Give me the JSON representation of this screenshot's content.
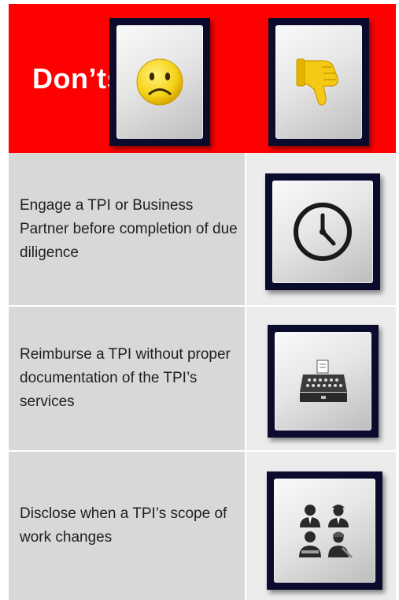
{
  "header": {
    "title": "Don’ts"
  },
  "icons": {
    "sad_face": "sad-face-icon",
    "thumbs_down": "thumbs-down-icon",
    "clock": "clock-icon",
    "cash_register": "cash-register-icon",
    "people": "people-icon"
  },
  "colors": {
    "header_background": "#ff0000",
    "header_text": "#ffffff",
    "text_cell_background": "#d8d8d8",
    "icon_cell_background": "#ececec",
    "tile_frame": "#0b0b2d",
    "emoji_yellow": "#f5d21a"
  },
  "rows": [
    {
      "text": "Engage a TPI or Business Partner before completion of due diligence",
      "icon": "clock-icon"
    },
    {
      "text": "Reimburse a TPI without proper documentation of the TPI’s services",
      "icon": "cash-register-icon"
    },
    {
      "text": "Disclose when a TPI’s scope of work changes",
      "icon": "people-icon"
    }
  ]
}
